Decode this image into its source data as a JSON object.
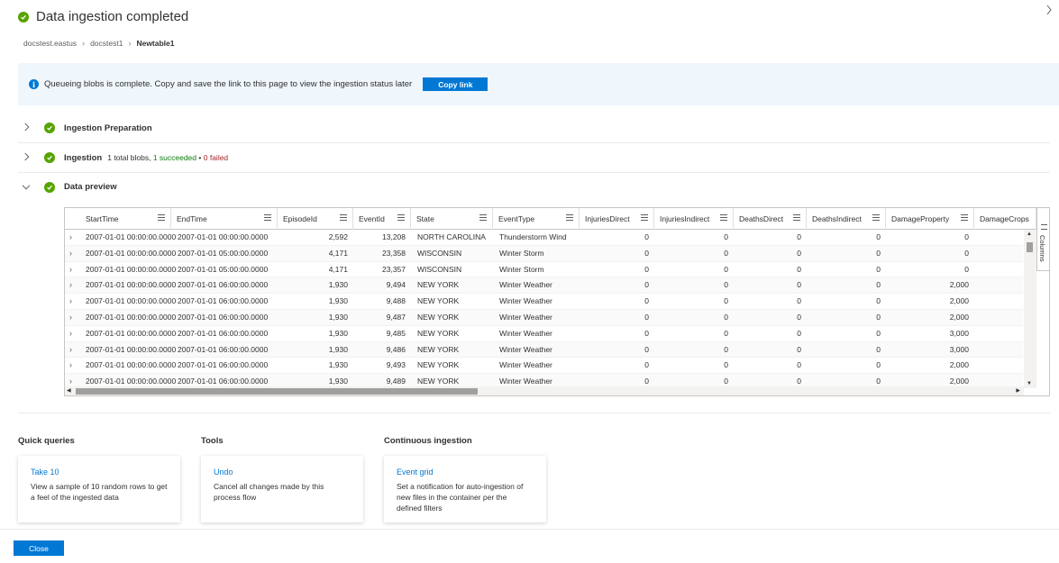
{
  "header": {
    "title": "Data ingestion completed"
  },
  "breadcrumb": [
    "docstest.eastus",
    "docstest1",
    "Newtable1"
  ],
  "banner": {
    "text": "Queueing blobs is complete. Copy and save the link to this page to view the ingestion status later",
    "button": "Copy link"
  },
  "sections": {
    "prep": {
      "label": "Ingestion Preparation"
    },
    "ingestion": {
      "label": "Ingestion",
      "total": "1 total blobs,",
      "succeeded": "1 succeeded",
      "dot": "•",
      "failed": "0 failed"
    },
    "preview": {
      "label": "Data preview"
    }
  },
  "grid": {
    "columns": [
      "StartTime",
      "EndTime",
      "EpisodeId",
      "EventId",
      "State",
      "EventType",
      "InjuriesDirect",
      "InjuriesIndirect",
      "DeathsDirect",
      "DeathsIndirect",
      "DamageProperty",
      "DamageCrops"
    ],
    "columns_panel": "Columns",
    "rows": [
      [
        "2007-01-01 00:00:00.0000",
        "2007-01-01 00:00:00.0000",
        "2,592",
        "13,208",
        "NORTH CAROLINA",
        "Thunderstorm Wind",
        "0",
        "0",
        "0",
        "0",
        "0",
        ""
      ],
      [
        "2007-01-01 00:00:00.0000",
        "2007-01-01 05:00:00.0000",
        "4,171",
        "23,358",
        "WISCONSIN",
        "Winter Storm",
        "0",
        "0",
        "0",
        "0",
        "0",
        ""
      ],
      [
        "2007-01-01 00:00:00.0000",
        "2007-01-01 05:00:00.0000",
        "4,171",
        "23,357",
        "WISCONSIN",
        "Winter Storm",
        "0",
        "0",
        "0",
        "0",
        "0",
        ""
      ],
      [
        "2007-01-01 00:00:00.0000",
        "2007-01-01 06:00:00.0000",
        "1,930",
        "9,494",
        "NEW YORK",
        "Winter Weather",
        "0",
        "0",
        "0",
        "0",
        "2,000",
        ""
      ],
      [
        "2007-01-01 00:00:00.0000",
        "2007-01-01 06:00:00.0000",
        "1,930",
        "9,488",
        "NEW YORK",
        "Winter Weather",
        "0",
        "0",
        "0",
        "0",
        "2,000",
        ""
      ],
      [
        "2007-01-01 00:00:00.0000",
        "2007-01-01 06:00:00.0000",
        "1,930",
        "9,487",
        "NEW YORK",
        "Winter Weather",
        "0",
        "0",
        "0",
        "0",
        "2,000",
        ""
      ],
      [
        "2007-01-01 00:00:00.0000",
        "2007-01-01 06:00:00.0000",
        "1,930",
        "9,485",
        "NEW YORK",
        "Winter Weather",
        "0",
        "0",
        "0",
        "0",
        "3,000",
        ""
      ],
      [
        "2007-01-01 00:00:00.0000",
        "2007-01-01 06:00:00.0000",
        "1,930",
        "9,486",
        "NEW YORK",
        "Winter Weather",
        "0",
        "0",
        "0",
        "0",
        "3,000",
        ""
      ],
      [
        "2007-01-01 00:00:00.0000",
        "2007-01-01 06:00:00.0000",
        "1,930",
        "9,493",
        "NEW YORK",
        "Winter Weather",
        "0",
        "0",
        "0",
        "0",
        "2,000",
        ""
      ],
      [
        "2007-01-01 00:00:00.0000",
        "2007-01-01 06:00:00.0000",
        "1,930",
        "9,489",
        "NEW YORK",
        "Winter Weather",
        "0",
        "0",
        "0",
        "0",
        "2,000",
        ""
      ]
    ]
  },
  "quick_links": [
    {
      "group": "Quick queries",
      "link": "Take 10",
      "desc": "View a sample of 10 random rows to get a feel of the ingested data"
    },
    {
      "group": "Tools",
      "link": "Undo",
      "desc": "Cancel all changes made by this process flow"
    },
    {
      "group": "Continuous ingestion",
      "link": "Event grid",
      "desc": "Set a notification for auto-ingestion of new files in the container per the defined filters"
    }
  ],
  "footer": {
    "close": "Close"
  },
  "colors": {
    "accent": "#0078d4",
    "success": "#57a300",
    "failed": "#a4262c",
    "banner_bg": "#eff6fc"
  }
}
